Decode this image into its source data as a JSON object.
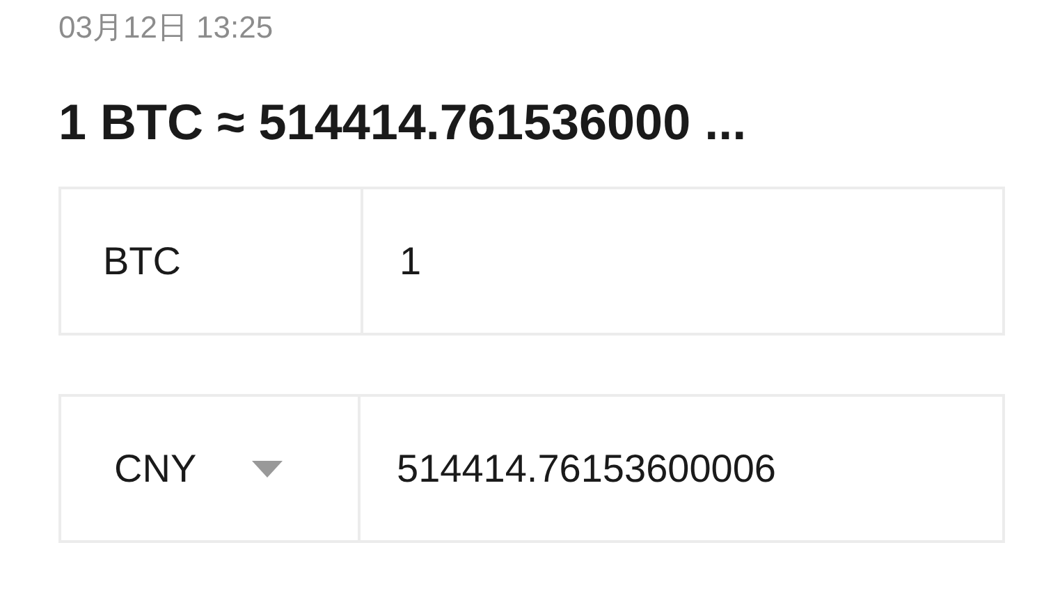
{
  "timestamp": "03月12日 13:25",
  "headline": "1 BTC ≈ 514414.761536000 ...",
  "converters": [
    {
      "kind": "fixed",
      "currency": "BTC",
      "amount": "1"
    },
    {
      "kind": "dropdown",
      "currency": "CNY",
      "amount": "514414.76153600006"
    }
  ]
}
